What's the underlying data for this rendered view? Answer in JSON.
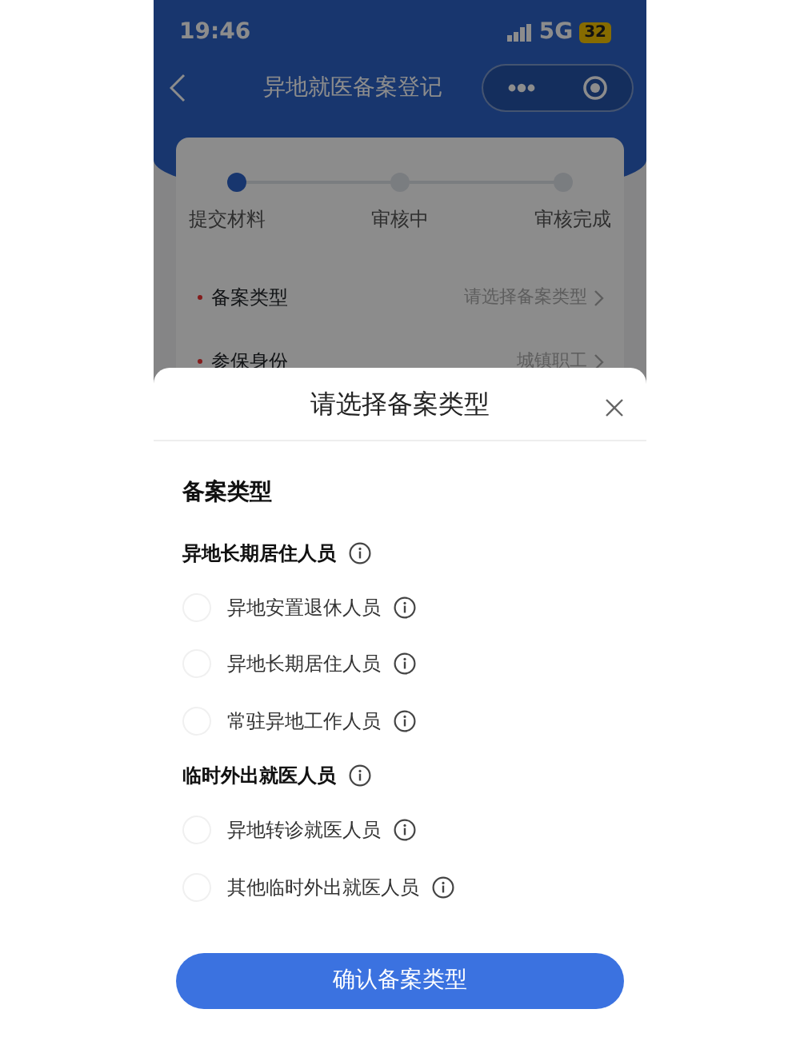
{
  "status_bar": {
    "time": "19:46",
    "network": "5G",
    "battery": "32"
  },
  "nav_bar": {
    "title": "异地就医备案登记"
  },
  "steps": [
    {
      "label": "提交材料",
      "active": true
    },
    {
      "label": "审核中",
      "active": false
    },
    {
      "label": "审核完成",
      "active": false
    }
  ],
  "form_rows": [
    {
      "label": "备案类型",
      "value": "请选择备案类型",
      "required": true
    },
    {
      "label": "参保身份",
      "value": "城镇职工",
      "required": true
    }
  ],
  "sheet": {
    "title": "请选择备案类型",
    "section_title": "备案类型",
    "groups": [
      {
        "title": "异地长期居住人员",
        "options": [
          {
            "label": "异地安置退休人员",
            "selected": false
          },
          {
            "label": "异地长期居住人员",
            "selected": false
          },
          {
            "label": "常驻异地工作人员",
            "selected": false
          }
        ]
      },
      {
        "title": "临时外出就医人员",
        "options": [
          {
            "label": "异地转诊就医人员",
            "selected": false
          },
          {
            "label": "其他临时外出就医人员",
            "selected": false
          }
        ]
      }
    ],
    "confirm_button": "确认备案类型"
  }
}
